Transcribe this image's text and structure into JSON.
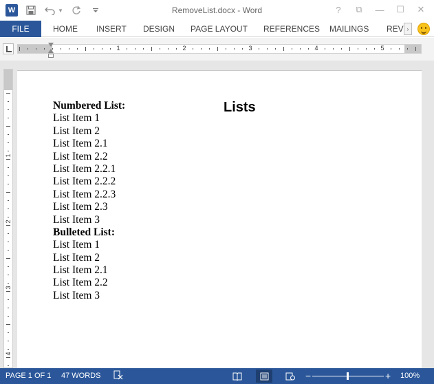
{
  "window": {
    "title": "RemoveList.docx - Word",
    "controls": {
      "help": "?",
      "ribbon_display": "⧉",
      "minimize": "—",
      "maximize": "☐",
      "close": "✕"
    }
  },
  "quick_access": {
    "app_icon": "W",
    "save_icon": "save-icon",
    "undo_icon": "undo-icon",
    "redo_icon": "redo-icon",
    "customize_icon": "customize-qat-icon"
  },
  "ribbon": {
    "tabs": [
      {
        "label": "FILE"
      },
      {
        "label": "HOME"
      },
      {
        "label": "INSERT"
      },
      {
        "label": "DESIGN"
      },
      {
        "label": "PAGE LAYOUT"
      },
      {
        "label": "REFERENCES"
      },
      {
        "label": "MAILINGS"
      },
      {
        "label": "REVIE"
      }
    ],
    "scroll_right": "›"
  },
  "ruler": {
    "numbers": [
      "1",
      "2",
      "3",
      "4",
      "5"
    ]
  },
  "vruler": {
    "numbers": [
      "1",
      "2",
      "3",
      "4"
    ]
  },
  "document": {
    "heading": "Lists",
    "lines": [
      {
        "text": "Numbered List:",
        "bold": true
      },
      {
        "text": "List Item 1",
        "bold": false
      },
      {
        "text": "List Item 2",
        "bold": false
      },
      {
        "text": "List Item 2.1",
        "bold": false
      },
      {
        "text": "List Item 2.2",
        "bold": false
      },
      {
        "text": "List Item 2.2.1",
        "bold": false
      },
      {
        "text": "List Item 2.2.2",
        "bold": false
      },
      {
        "text": "List Item 2.2.3",
        "bold": false
      },
      {
        "text": "List Item 2.3",
        "bold": false
      },
      {
        "text": "List Item 3",
        "bold": false
      },
      {
        "text": "Bulleted List:",
        "bold": true
      },
      {
        "text": "List Item 1",
        "bold": false
      },
      {
        "text": "List Item 2",
        "bold": false
      },
      {
        "text": "List Item 2.1",
        "bold": false
      },
      {
        "text": "List Item 2.2",
        "bold": false
      },
      {
        "text": "List Item 3",
        "bold": false
      }
    ]
  },
  "status": {
    "page": "PAGE 1 OF 1",
    "words": "47 WORDS",
    "zoom_minus": "−",
    "zoom_plus": "+",
    "zoom": "100%"
  },
  "colors": {
    "accent": "#2b579a",
    "workspace": "#e6e6e6"
  }
}
